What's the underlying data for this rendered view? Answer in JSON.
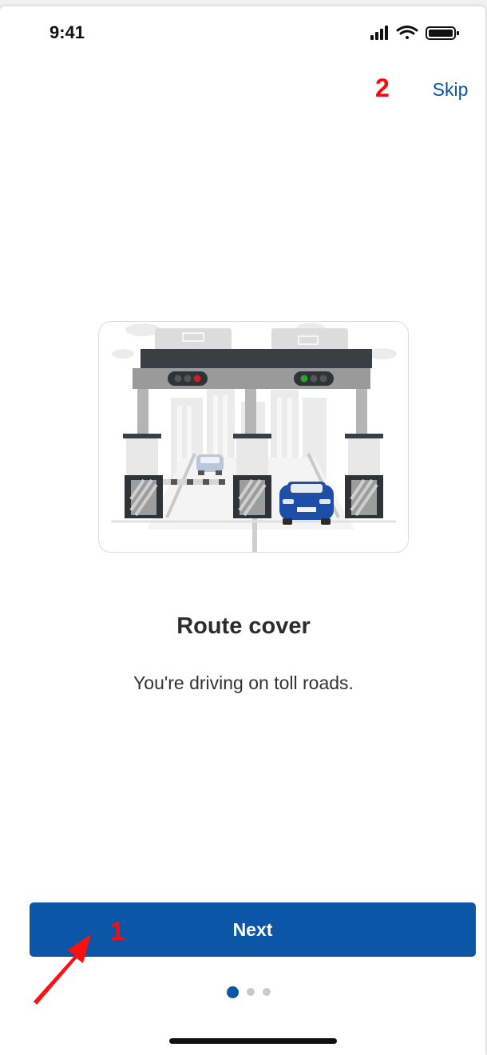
{
  "status_bar": {
    "time": "9:41"
  },
  "header": {
    "skip_label": "Skip"
  },
  "annotations": {
    "label_1": "1",
    "label_2": "2"
  },
  "onboarding": {
    "illustration": "toll-plaza-illustration",
    "title": "Route cover",
    "description": "You're driving on toll roads.",
    "next_label": "Next",
    "page_indicator": {
      "total": 3,
      "current": 1
    }
  },
  "colors": {
    "accent": "#0b56a6",
    "annotation": "#ff0a0a",
    "traffic_red": "#cc1f1f",
    "traffic_green": "#2aa52a"
  }
}
